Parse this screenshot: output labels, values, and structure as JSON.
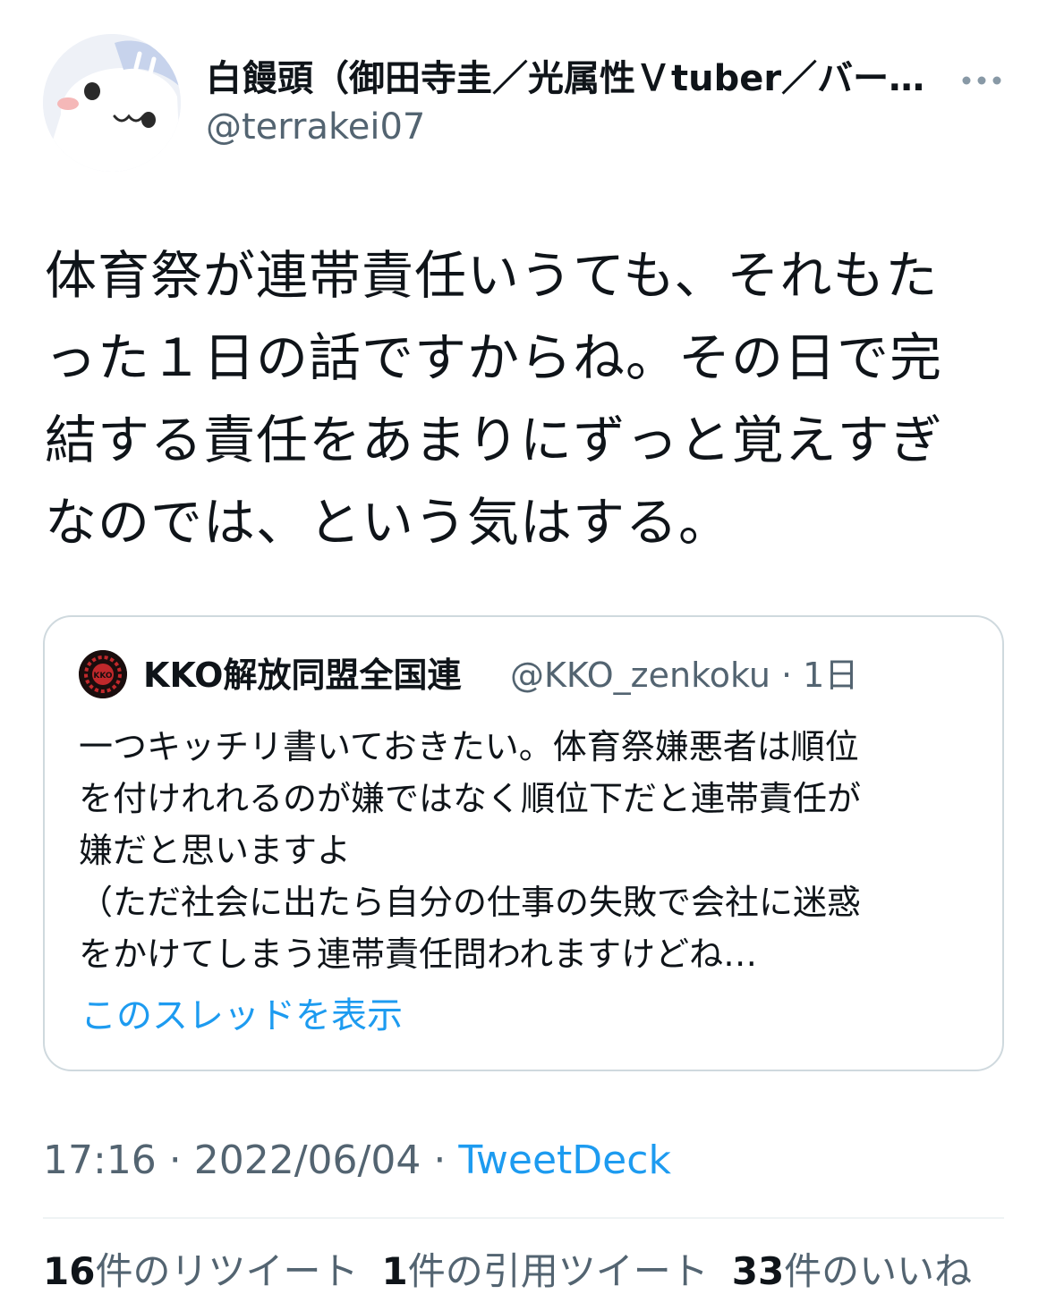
{
  "author": {
    "display_name": "白饅頭（御田寺圭／光属性Ｖtuber／バー…",
    "handle": "@terrakei07",
    "avatar_icon": "white-blob-mascot-icon",
    "more_icon": "more-horizontal-icon"
  },
  "tweet": {
    "lines": [
      "体育祭が連帯責任いうても、それもた",
      "った１日の話ですからね。その日で完",
      "結する責任をあまりにずっと覚えすぎ",
      "なのでは、という気はする。"
    ]
  },
  "quote": {
    "avatar_icon": "kko-logo-icon",
    "avatar_text": "KKO",
    "display_name": "KKO解放同盟全国連",
    "handle_time": "@KKO_zenkoku · 1日",
    "lines": [
      "一つキッチリ書いておきたい。体育祭嫌悪者は順位",
      "を付けれれるのが嫌ではなく順位下だと連帯責任が",
      "嫌だと思いますよ",
      "（ただ社会に出たら自分の仕事の失敗で会社に迷惑",
      "をかけてしまう連帯責任問われますけどね…"
    ],
    "show_thread": "このスレッドを表示"
  },
  "meta": {
    "time_date": "17:16 · 2022/06/04 · ",
    "source": "TweetDeck"
  },
  "stats": {
    "retweets_count": "16",
    "retweets_label": "件のリツイート",
    "quotes_count": "1",
    "quotes_label": "件の引用ツイート",
    "likes_count": "33",
    "likes_label": "件のいいね"
  },
  "colors": {
    "link": "#1d9bf0",
    "muted": "#536471",
    "text": "#0f1419",
    "border": "#cfd9de"
  }
}
